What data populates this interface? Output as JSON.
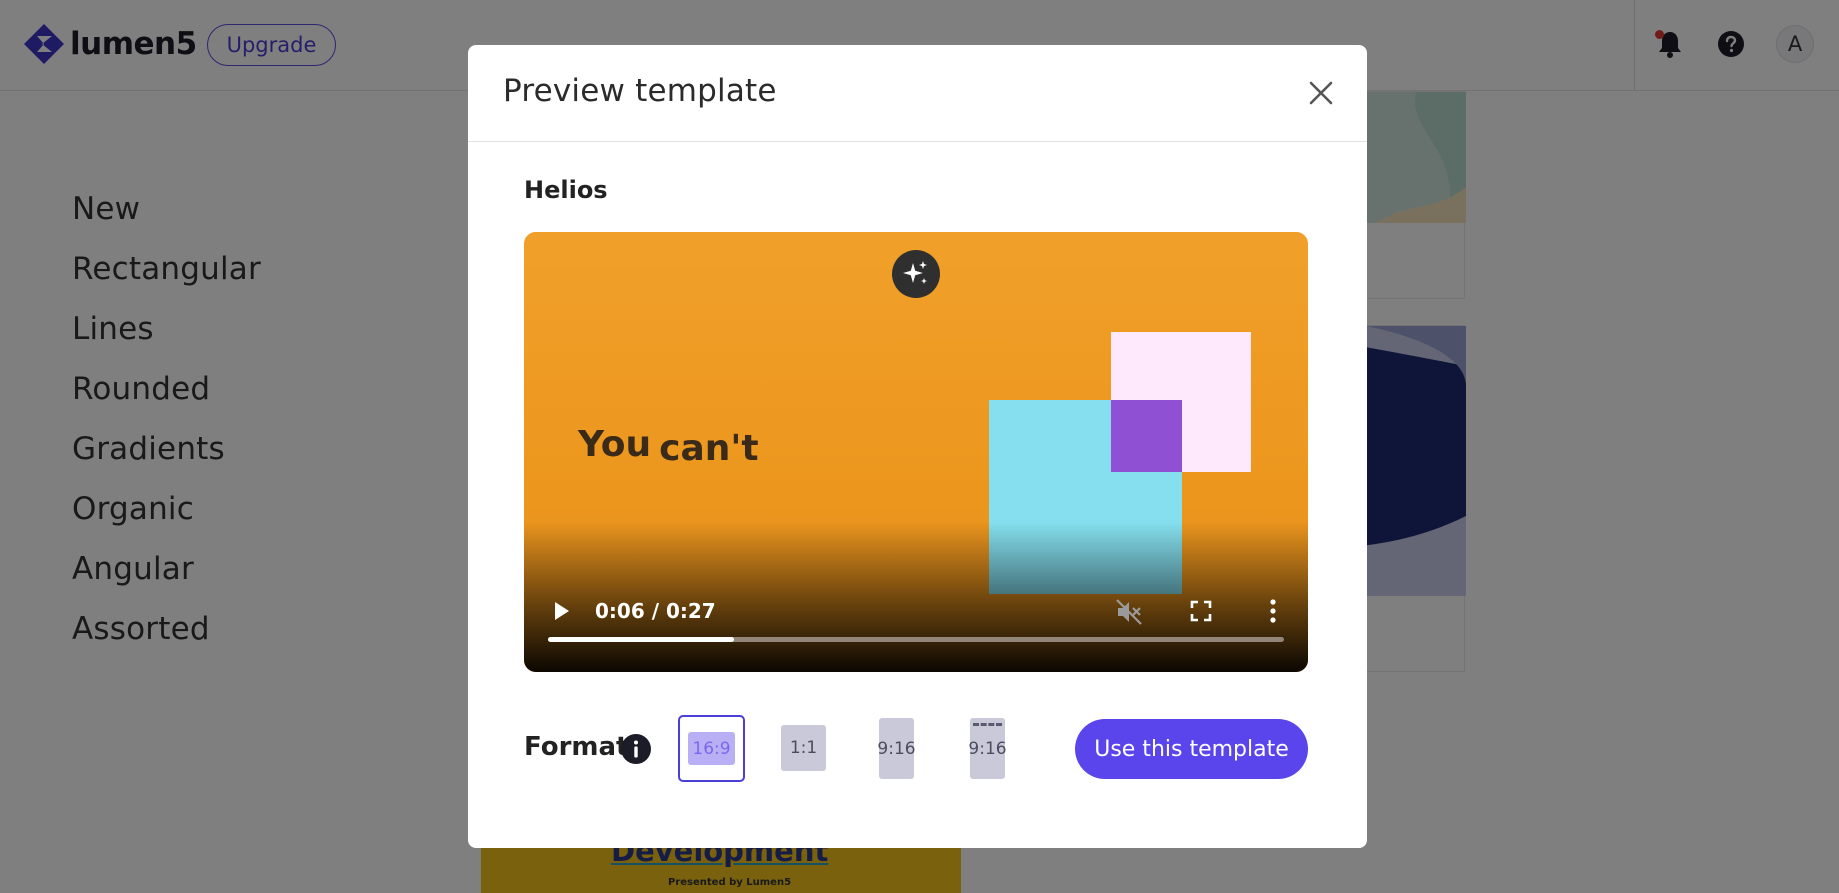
{
  "app": {
    "brand_name": "lumen5",
    "upgrade_label": "Upgrade",
    "avatar_initial": "A",
    "icons": {
      "logo": "lumen5-logo-icon",
      "notifications": "bell-icon",
      "help": "help-icon"
    },
    "colors": {
      "accent": "#5a45ec",
      "notification_dot": "#e53935"
    }
  },
  "sidebar": {
    "categories": [
      {
        "label": "New"
      },
      {
        "label": "Rectangular"
      },
      {
        "label": "Lines"
      },
      {
        "label": "Rounded"
      },
      {
        "label": "Gradients"
      },
      {
        "label": "Organic"
      },
      {
        "label": "Angular"
      },
      {
        "label": "Assorted"
      }
    ]
  },
  "background_cards": {
    "card_c_title": "Development",
    "card_c_subtitle": "Presented by Lumen5"
  },
  "modal": {
    "title": "Preview template",
    "close_icon": "close-icon",
    "template_name": "Helios",
    "video": {
      "caption": {
        "word1": "You",
        "word2": "can't"
      },
      "time_display": "0:06 / 0:27",
      "progress": 0.253,
      "muted": true,
      "icons": {
        "magic": "sparkle-icon",
        "play": "play-icon",
        "mute": "volume-muted-icon",
        "fullscreen": "fullscreen-icon",
        "more": "more-vertical-icon"
      },
      "colors": {
        "background": "#ee9a22",
        "pink": "#fde9fb",
        "cyan": "#85dfee",
        "purple": "#8f50d4"
      }
    },
    "format": {
      "label": "Format",
      "info_icon": "info-icon",
      "options": [
        {
          "label": "16:9",
          "selected": true
        },
        {
          "label": "1:1",
          "selected": false
        },
        {
          "label": "9:16",
          "selected": false
        },
        {
          "label": "9:16",
          "selected": false
        }
      ]
    },
    "use_button_label": "Use this template"
  }
}
